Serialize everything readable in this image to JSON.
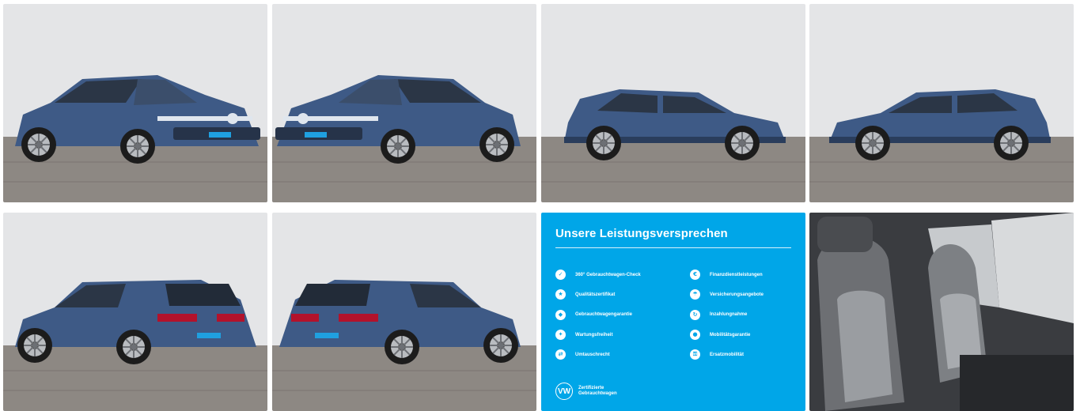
{
  "gallery": {
    "photos": [
      {
        "icon": "car-front-left-photo-icon"
      },
      {
        "icon": "car-front-right-photo-icon"
      },
      {
        "icon": "car-side-left-photo-icon"
      },
      {
        "icon": "car-side-right-photo-icon"
      },
      {
        "icon": "car-rear-left-photo-icon"
      },
      {
        "icon": "car-rear-right-photo-icon"
      },
      {
        "icon": "interior-seats-photo-icon"
      }
    ],
    "promo": {
      "title": "Unsere Leistungsversprechen",
      "left": [
        {
          "label": "360° Gebrauchtwagen-Check",
          "icon": "check-icon"
        },
        {
          "label": "Qualitätszertifikat",
          "icon": "certificate-icon"
        },
        {
          "label": "Gebrauchtwagengarantie",
          "icon": "shield-icon"
        },
        {
          "label": "Wartungsfreiheit",
          "icon": "wrench-icon"
        },
        {
          "label": "Umtauschrecht",
          "icon": "exchange-icon"
        }
      ],
      "right": [
        {
          "label": "Finanzdienstleistungen",
          "icon": "money-icon"
        },
        {
          "label": "Versicherungsangebote",
          "icon": "umbrella-icon"
        },
        {
          "label": "Inzahlungnahme",
          "icon": "trade-in-icon"
        },
        {
          "label": "Mobilitätsgarantie",
          "icon": "car-icon"
        },
        {
          "label": "Ersatzmobilität",
          "icon": "key-icon"
        }
      ],
      "logo_line1": "Zertifizierte",
      "logo_line2": "Gebrauchtwagen",
      "logo_mark": "VW"
    },
    "colors": {
      "brand_blue": "#00a6e8",
      "car_blue": "#3e5a86"
    }
  }
}
